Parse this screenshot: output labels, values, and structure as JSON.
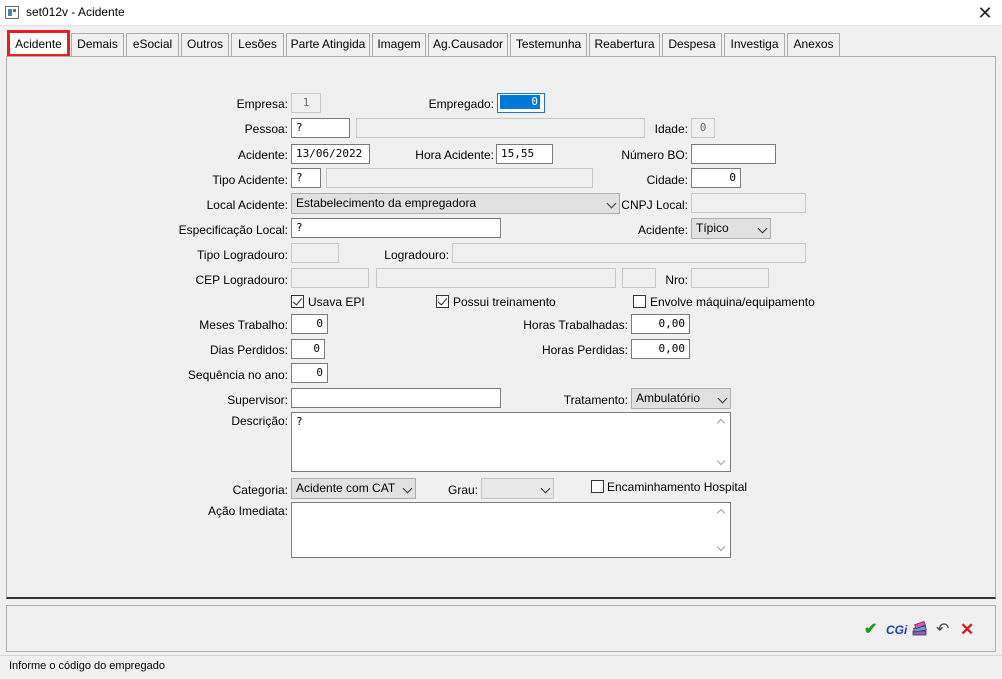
{
  "window": {
    "title": "set012v - Acidente",
    "close_glyph": "✕"
  },
  "tabs": [
    {
      "label": "Acidente",
      "active": true
    },
    {
      "label": "Demais"
    },
    {
      "label": "eSocial"
    },
    {
      "label": "Outros"
    },
    {
      "label": "Lesões"
    },
    {
      "label": "Parte Atingida"
    },
    {
      "label": "Imagem"
    },
    {
      "label": "Ag.Causador"
    },
    {
      "label": "Testemunha"
    },
    {
      "label": "Reabertura"
    },
    {
      "label": "Despesa"
    },
    {
      "label": "Investiga"
    },
    {
      "label": "Anexos"
    }
  ],
  "form": {
    "empresa": {
      "label": "Empresa:",
      "value": "1"
    },
    "empregado": {
      "label": "Empregado:",
      "value": "0"
    },
    "pessoa": {
      "label": "Pessoa:",
      "value": "?",
      "name_value": ""
    },
    "idade": {
      "label": "Idade:",
      "value": "0"
    },
    "acidente_data": {
      "label": "Acidente:",
      "value": "13/06/2022"
    },
    "hora_acidente": {
      "label": "Hora Acidente:",
      "value": "15,55"
    },
    "numero_bo": {
      "label": "Número BO:",
      "value": ""
    },
    "tipo_acidente": {
      "label": "Tipo Acidente:",
      "value": "?",
      "desc_value": ""
    },
    "cidade": {
      "label": "Cidade:",
      "value": "0"
    },
    "local_acidente": {
      "label": "Local Acidente:",
      "value": "Estabelecimento da empregadora"
    },
    "cnpj_local": {
      "label": "CNPJ Local:",
      "value": ""
    },
    "especificacao_local": {
      "label": "Especificação Local:",
      "value": "?"
    },
    "acidente_tipo": {
      "label": "Acidente:",
      "value": "Típico"
    },
    "tipo_logradouro": {
      "label": "Tipo Logradouro:",
      "value": ""
    },
    "logradouro": {
      "label": "Logradouro:",
      "value": ""
    },
    "cep_logradouro": {
      "label": "CEP Logradouro:",
      "value": ""
    },
    "nro": {
      "label": "Nro:",
      "value": ""
    },
    "usava_epi": {
      "label": "Usava EPI",
      "checked": true
    },
    "possui_treinamento": {
      "label": "Possui treinamento",
      "checked": true
    },
    "envolve_maquina": {
      "label": "Envolve máquina/equipamento",
      "checked": false
    },
    "meses_trabalho": {
      "label": "Meses Trabalho:",
      "value": "0"
    },
    "horas_trabalhadas": {
      "label": "Horas Trabalhadas:",
      "value": "0,00"
    },
    "dias_perdidos": {
      "label": "Dias Perdidos:",
      "value": "0"
    },
    "horas_perdidas": {
      "label": "Horas Perdidas:",
      "value": "0,00"
    },
    "sequencia_ano": {
      "label": "Sequência no ano:",
      "value": "0"
    },
    "supervisor": {
      "label": "Supervisor:",
      "value": ""
    },
    "tratamento": {
      "label": "Tratamento:",
      "value": "Ambulatório"
    },
    "descricao": {
      "label": "Descrição:",
      "value": "?"
    },
    "categoria": {
      "label": "Categoria:",
      "value": "Acidente com CAT"
    },
    "grau": {
      "label": "Grau:",
      "value": ""
    },
    "encaminhamento_hospital": {
      "label": "Encaminhamento Hospital",
      "checked": false
    },
    "acao_imediata": {
      "label": "Ação Imediata:",
      "value": ""
    }
  },
  "toolbar": {
    "confirm_glyph": "✔",
    "cgi_label": "CGi",
    "undo_glyph": "↶",
    "cancel_glyph": "✕"
  },
  "status": {
    "text": "Informe o código do empregado"
  },
  "colors": {
    "confirm": "#1a9a1a",
    "cgi": "#1a3fb8",
    "cancel": "#d41c1c",
    "active_tab_highlight": "#e3202a",
    "selection": "#0078d7"
  }
}
